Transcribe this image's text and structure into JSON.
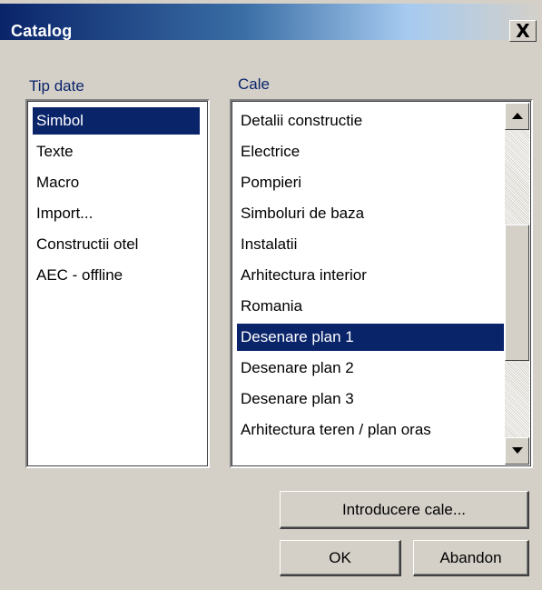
{
  "window": {
    "title": "Catalog",
    "close_symbol": "X"
  },
  "left_panel": {
    "label": "Tip date",
    "items": [
      {
        "label": "Simbol",
        "selected": true
      },
      {
        "label": "Texte",
        "selected": false
      },
      {
        "label": "Macro",
        "selected": false
      },
      {
        "label": "Import...",
        "selected": false
      },
      {
        "label": "Constructii otel",
        "selected": false
      },
      {
        "label": "AEC - offline",
        "selected": false
      }
    ]
  },
  "right_panel": {
    "label": "Cale",
    "items": [
      {
        "label": "Detalii constructie",
        "selected": false
      },
      {
        "label": "Electrice",
        "selected": false
      },
      {
        "label": "Pompieri",
        "selected": false
      },
      {
        "label": "Simboluri de baza",
        "selected": false
      },
      {
        "label": "Instalatii",
        "selected": false
      },
      {
        "label": "Arhitectura interior",
        "selected": false
      },
      {
        "label": "Romania",
        "selected": false
      },
      {
        "label": "Desenare plan 1",
        "selected": true
      },
      {
        "label": "Desenare plan 2",
        "selected": false
      },
      {
        "label": "Desenare plan 3",
        "selected": false
      },
      {
        "label": "Arhitectura teren / plan oras",
        "selected": false
      }
    ],
    "scrollbar": {
      "icons": [
        "arrow-up-icon",
        "arrow-down-icon"
      ]
    }
  },
  "buttons": {
    "introducere_cale": "Introducere cale...",
    "ok": "OK",
    "abandon": "Abandon"
  },
  "colors": {
    "selection": "#0a246a",
    "title_gradient_start": "#0a246a",
    "label": "#0a246a",
    "face": "#d4d0c8"
  }
}
